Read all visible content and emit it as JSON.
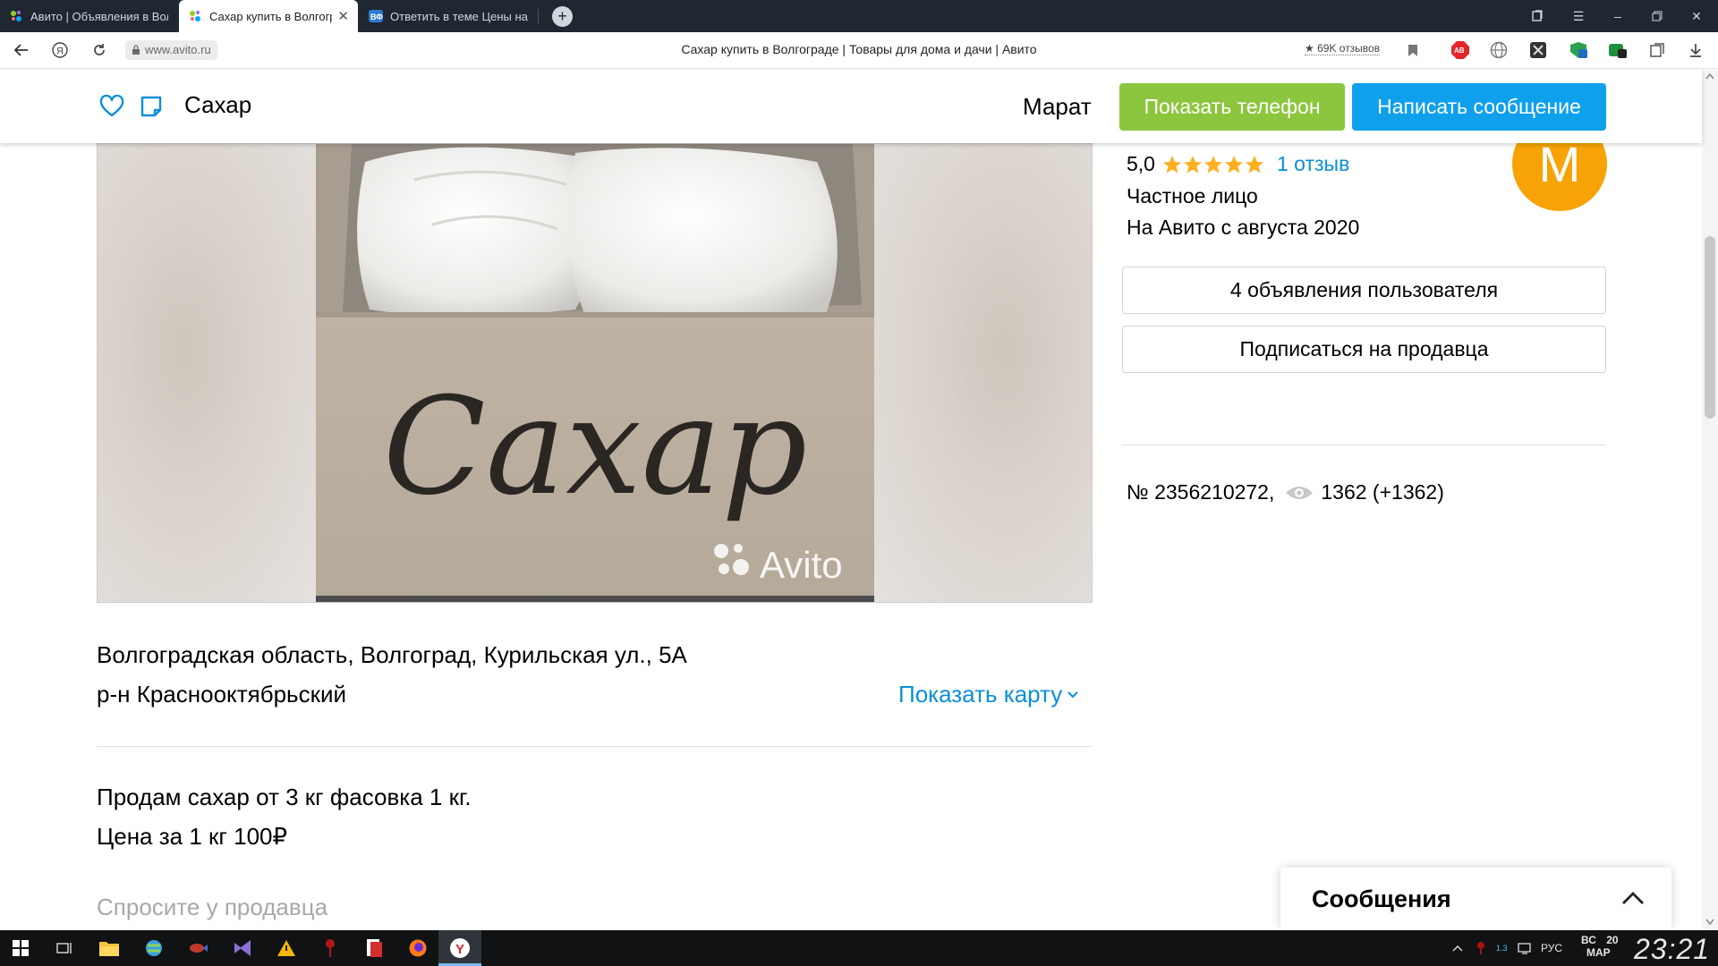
{
  "browser": {
    "tabs": [
      {
        "title": "Авито | Объявления в Волгограде"
      },
      {
        "title": "Сахар купить в Волгограде"
      },
      {
        "title": "Ответить в теме Цены на"
      }
    ],
    "url": "www.avito.ru",
    "page_title": "Сахар купить в Волгограде | Товары для дома и дачи | Авито",
    "reviews_badge": "★ 69K отзывов"
  },
  "header": {
    "title": "Сахар",
    "seller_name": "Марат",
    "phone_button": "Показать телефон",
    "message_button": "Написать сообщение"
  },
  "photo": {
    "handwritten_text": "Сахар",
    "watermark": "Avito"
  },
  "seller": {
    "rating": "5,0",
    "stars": 5,
    "reviews": "1 отзыв",
    "type": "Частное лицо",
    "since": "На Авито с августа 2020",
    "avatar_letter": "M",
    "avatar_color": "#f7a305",
    "ads_button": "4 объявления пользователя",
    "subscribe_button": "Подписаться на продавца"
  },
  "listing": {
    "number": "№ 2356210272,",
    "views": "1362 (+1362)",
    "address_line": "Волгоградская область, Волгоград, Курильская ул., 5А",
    "district": "р-н Краснооктябрьский",
    "show_map": "Показать карту",
    "description": [
      "Продам сахар от 3 кг фасовка 1 кг.",
      "Цена за 1 кг 100₽"
    ],
    "ask_seller": "Спросите у продавца"
  },
  "messages_widget": {
    "label": "Сообщения"
  },
  "taskbar": {
    "language": "РУС",
    "day_of_week": "ВС",
    "date_day": "20",
    "date_month": "МАР",
    "time": "23:21"
  },
  "colors": {
    "phone_button": "#8cc63e",
    "message_button": "#0fa0ec",
    "link": "#0a8fd9",
    "star": "#ffb021"
  }
}
